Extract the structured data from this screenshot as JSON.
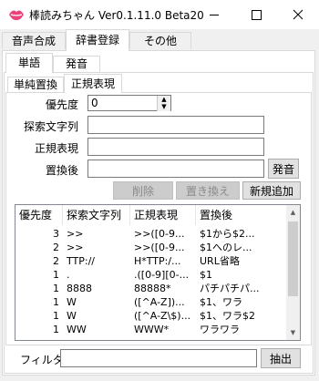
{
  "window": {
    "title": "棒読みちゃん Ver0.1.11.0 Beta20",
    "app_icon": "lips-icon"
  },
  "main_tabs": [
    "音声合成",
    "辞書登録",
    "その他"
  ],
  "sub_tabs": [
    "単語",
    "発音"
  ],
  "inner_tabs": [
    "単純置換",
    "正規表現"
  ],
  "form": {
    "priority_label": "優先度",
    "priority_value": "0",
    "search_label": "探索文字列",
    "search_value": "",
    "regex_label": "正規表現",
    "regex_value": "",
    "replace_label": "置換後",
    "replace_value": "",
    "pronounce_button": "発音"
  },
  "actions": {
    "delete": "削除",
    "replace": "置き換え",
    "new": "新規追加"
  },
  "table": {
    "columns": [
      "優先度",
      "探索文字列",
      "正規表現",
      "置換後"
    ],
    "rows": [
      [
        "3",
        ">>",
        ">>([0-9...",
        "$1から$2..."
      ],
      [
        "2",
        ">>",
        ">>([0-9...",
        "$1へのレ..."
      ],
      [
        "2",
        "TTP://",
        "H*TTP:/...",
        "URL省略"
      ],
      [
        "1",
        ".",
        ".([0-9][0-...",
        "$1"
      ],
      [
        "1",
        "8888",
        "88888*",
        "パチパチパ..."
      ],
      [
        "1",
        "W",
        "([^A-Z])...",
        "$1、ワラ"
      ],
      [
        "1",
        "W",
        "([^A-Z\\$)...",
        "$1、ワラ$2"
      ],
      [
        "1",
        "WW",
        "WWW*",
        "ワラワラ"
      ]
    ]
  },
  "filter": {
    "label": "フィルタ",
    "value": "",
    "button": "抽出"
  }
}
